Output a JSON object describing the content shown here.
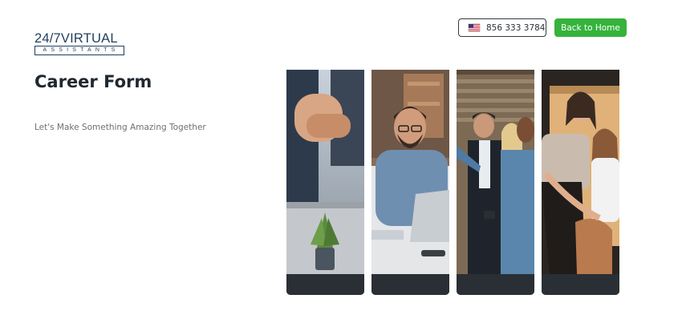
{
  "header": {
    "logo": {
      "top_text": "24/7VIRTUAL",
      "bottom_text": "ASSISTANTS"
    },
    "phone": {
      "flag_icon": "us-flag-icon",
      "number": "856 333 3784"
    },
    "home_button_label": "Back to Home",
    "accent_color": "#35b33c"
  },
  "hero": {
    "title": "Career Form",
    "tagline": "Let's Make Something Amazing Together"
  },
  "gallery": {
    "photos": [
      {
        "subject": "team-hands-stacked-photo"
      },
      {
        "subject": "smiling-man-laptop-photo"
      },
      {
        "subject": "team-pointing-photo"
      },
      {
        "subject": "laughing-women-photo"
      }
    ]
  }
}
